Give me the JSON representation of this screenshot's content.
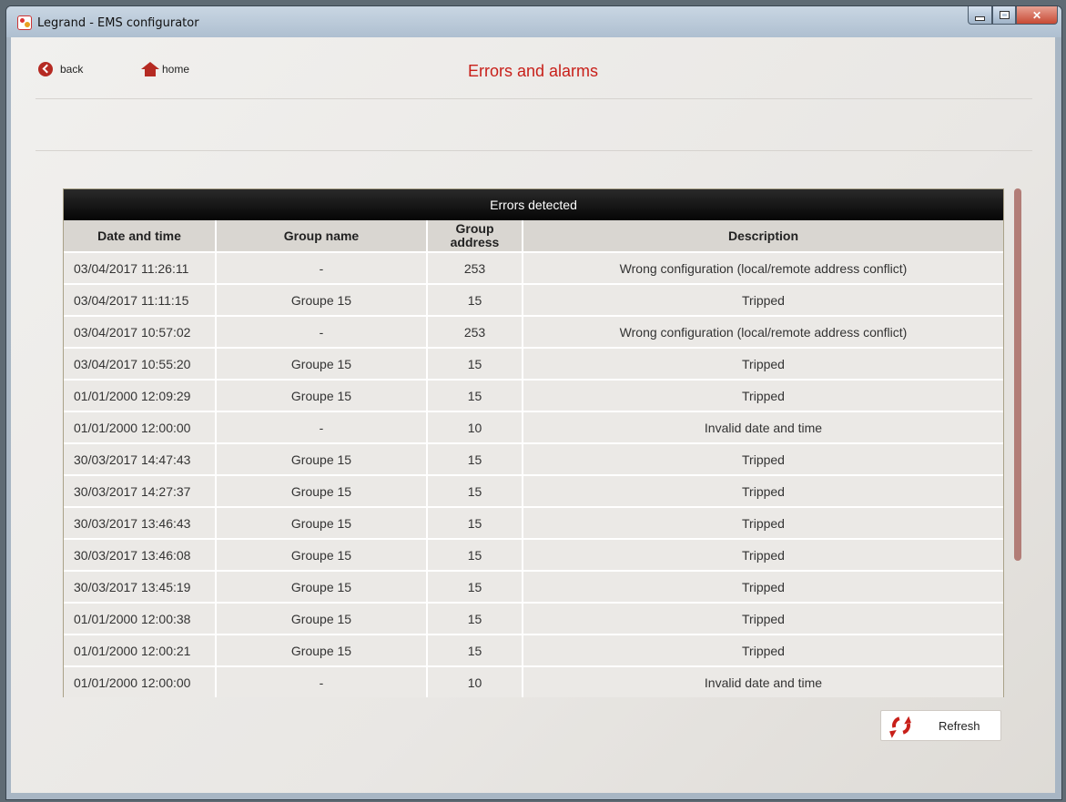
{
  "window": {
    "title": "Legrand - EMS configurator"
  },
  "nav": {
    "back_label": "back",
    "home_label": "home",
    "page_title": "Errors and alarms"
  },
  "errors_table": {
    "caption": "Errors detected",
    "headers": {
      "date_time": "Date and time",
      "group_name": "Group name",
      "group_address_1": "Group",
      "group_address_2": "address",
      "description": "Description"
    },
    "rows": [
      {
        "date_time": "03/04/2017 11:26:11",
        "group_name": "-",
        "group_address": "253",
        "description": "Wrong configuration (local/remote address conflict)"
      },
      {
        "date_time": "03/04/2017 11:11:15",
        "group_name": "Groupe  15",
        "group_address": "15",
        "description": "Tripped"
      },
      {
        "date_time": "03/04/2017 10:57:02",
        "group_name": "-",
        "group_address": "253",
        "description": "Wrong configuration (local/remote address conflict)"
      },
      {
        "date_time": "03/04/2017 10:55:20",
        "group_name": "Groupe  15",
        "group_address": "15",
        "description": "Tripped"
      },
      {
        "date_time": "01/01/2000 12:09:29",
        "group_name": "Groupe  15",
        "group_address": "15",
        "description": "Tripped"
      },
      {
        "date_time": "01/01/2000 12:00:00",
        "group_name": "-",
        "group_address": "10",
        "description": "Invalid date and time"
      },
      {
        "date_time": "30/03/2017 14:47:43",
        "group_name": "Groupe  15",
        "group_address": "15",
        "description": "Tripped"
      },
      {
        "date_time": "30/03/2017 14:27:37",
        "group_name": "Groupe  15",
        "group_address": "15",
        "description": "Tripped"
      },
      {
        "date_time": "30/03/2017 13:46:43",
        "group_name": "Groupe  15",
        "group_address": "15",
        "description": "Tripped"
      },
      {
        "date_time": "30/03/2017 13:46:08",
        "group_name": "Groupe  15",
        "group_address": "15",
        "description": "Tripped"
      },
      {
        "date_time": "30/03/2017 13:45:19",
        "group_name": "Groupe  15",
        "group_address": "15",
        "description": "Tripped"
      },
      {
        "date_time": "01/01/2000 12:00:38",
        "group_name": "Groupe  15",
        "group_address": "15",
        "description": "Tripped"
      },
      {
        "date_time": "01/01/2000 12:00:21",
        "group_name": "Groupe  15",
        "group_address": "15",
        "description": "Tripped"
      },
      {
        "date_time": "01/01/2000 12:00:00",
        "group_name": "-",
        "group_address": "10",
        "description": "Invalid date and time"
      }
    ]
  },
  "refresh": {
    "label": "Refresh"
  },
  "colors": {
    "accent_red": "#c8201a",
    "caption_bg": "#000000",
    "scroll_thumb": "#b27d77"
  }
}
